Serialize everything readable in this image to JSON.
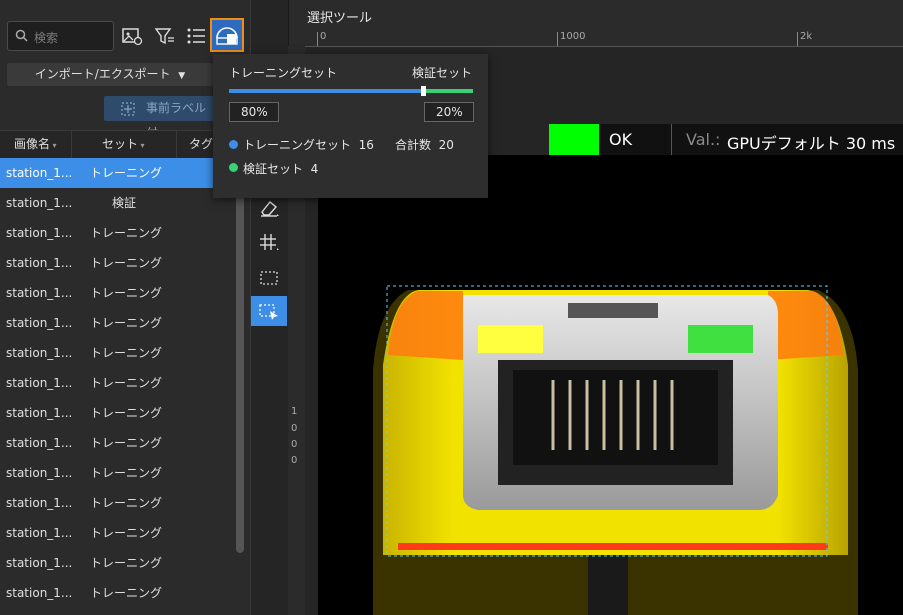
{
  "colors": {
    "accent": "#3d8ee6",
    "validation": "#38d17a",
    "ok": "#00ff00",
    "highlight_border": "#f08c1a"
  },
  "search": {
    "placeholder": "検索"
  },
  "left_panel": {
    "import_export_label": "インポート/エクスポート",
    "prelabel_label": "事前ラベル付",
    "columns": {
      "image_name": "画像名",
      "set": "セット",
      "tag": "タグ"
    },
    "rows": [
      {
        "name": "station_1...",
        "set": "トレーニング",
        "selected": true
      },
      {
        "name": "station_1...",
        "set": "検証"
      },
      {
        "name": "station_1...",
        "set": "トレーニング"
      },
      {
        "name": "station_1...",
        "set": "トレーニング"
      },
      {
        "name": "station_1...",
        "set": "トレーニング"
      },
      {
        "name": "station_1...",
        "set": "トレーニング"
      },
      {
        "name": "station_1...",
        "set": "トレーニング"
      },
      {
        "name": "station_1...",
        "set": "トレーニング"
      },
      {
        "name": "station_1...",
        "set": "トレーニング"
      },
      {
        "name": "station_1...",
        "set": "トレーニング"
      },
      {
        "name": "station_1...",
        "set": "トレーニング"
      },
      {
        "name": "station_1...",
        "set": "トレーニング"
      },
      {
        "name": "station_1...",
        "set": "トレーニング"
      },
      {
        "name": "station_1...",
        "set": "トレーニング"
      },
      {
        "name": "station_1...",
        "set": "トレーニング"
      }
    ]
  },
  "main": {
    "title": "選択ツール",
    "ruler_top": [
      "0",
      "1000",
      "2k"
    ],
    "ruler_left": [
      "1",
      "0",
      "0",
      "0"
    ]
  },
  "status": {
    "result": "OK",
    "val_label": "Val.:",
    "val_text": "GPUデフォルト 30 ms"
  },
  "split_popup": {
    "train_label": "トレーニングセット",
    "val_label": "検証セット",
    "train_ratio": 0.8,
    "train_percent": "80%",
    "val_percent": "20%",
    "train_stat": "トレーニングセット  16",
    "total_stat": "合計数  20",
    "val_stat": "検証セット  4"
  }
}
